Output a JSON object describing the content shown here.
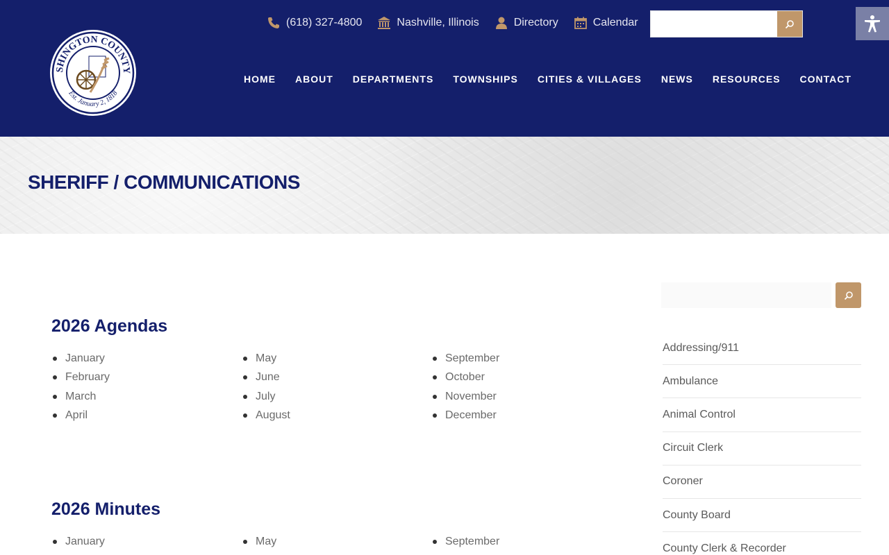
{
  "header": {
    "logo": {
      "top_text": "WASHINGTON COUNTY, IL",
      "bottom_text": "Est. January 2, 1818"
    },
    "topbar": [
      {
        "label": "(618) 327-4800",
        "icon": "phone-icon"
      },
      {
        "label": "Nashville, Illinois",
        "icon": "courthouse-icon"
      },
      {
        "label": "Directory",
        "icon": "person-icon"
      },
      {
        "label": "Calendar",
        "icon": "calendar-icon"
      }
    ],
    "search_placeholder": "",
    "nav": [
      "HOME",
      "ABOUT",
      "DEPARTMENTS",
      "TOWNSHIPS",
      "CITIES & VILLAGES",
      "NEWS",
      "RESOURCES",
      "CONTACT"
    ]
  },
  "banner": {
    "title": "SHERIFF / COMMUNICATIONS"
  },
  "main": {
    "agendas": {
      "title": "2026 Agendas",
      "col1": [
        "January",
        "February",
        "March",
        "April"
      ],
      "col2": [
        "May",
        "June",
        "July",
        "August"
      ],
      "col3": [
        "September",
        "October",
        "November",
        "December"
      ]
    },
    "minutes": {
      "title": "2026 Minutes",
      "col1": [
        "January"
      ],
      "col2": [
        "May"
      ],
      "col3": [
        "September"
      ]
    }
  },
  "sidebar": {
    "search_placeholder": "",
    "items": [
      "Addressing/911",
      "Ambulance",
      "Animal Control",
      "Circuit Clerk",
      "Coroner",
      "County Board",
      "County Clerk & Recorder"
    ]
  },
  "colors": {
    "navy": "#141f6b",
    "gold": "#c0976a",
    "a11y": "#7a80a6"
  }
}
